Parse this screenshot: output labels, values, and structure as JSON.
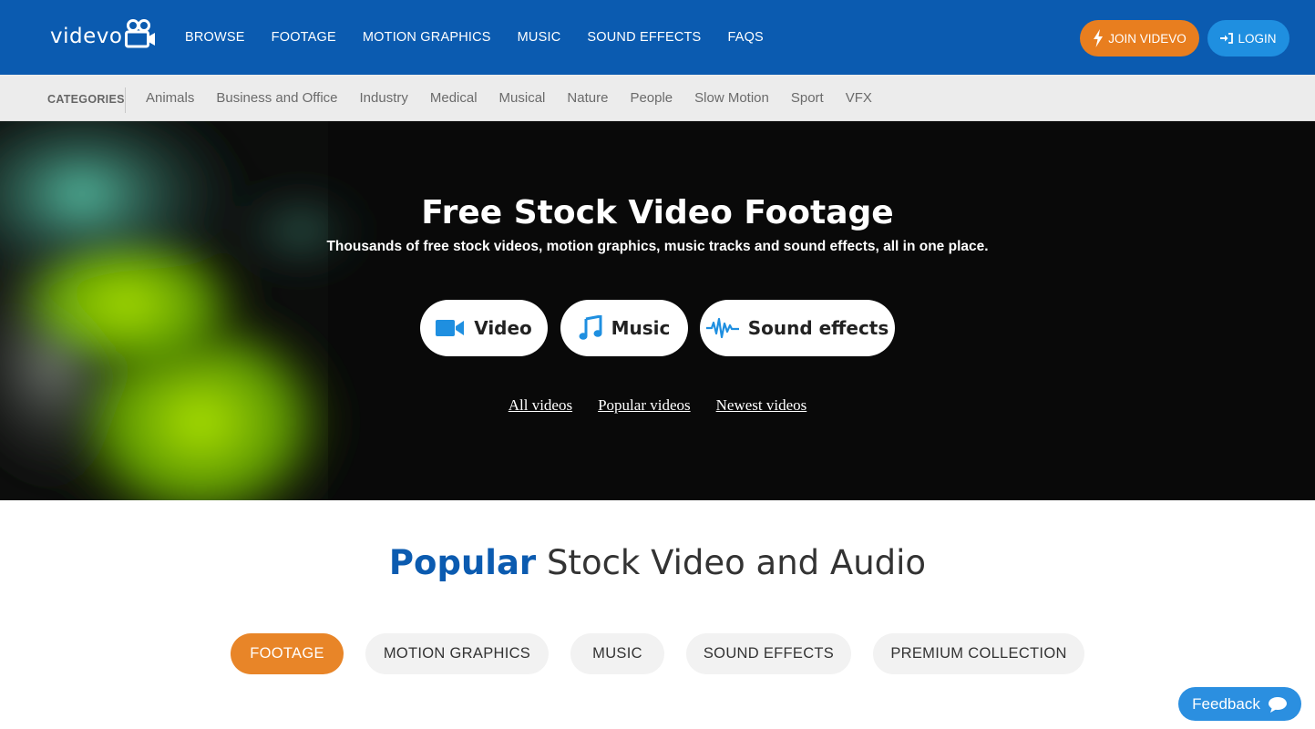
{
  "brand": {
    "name": "videvo"
  },
  "nav": {
    "items": [
      "BROWSE",
      "FOOTAGE",
      "MOTION GRAPHICS",
      "MUSIC",
      "SOUND EFFECTS",
      "FAQS"
    ],
    "join_label": "JOIN VIDEVO",
    "login_label": "LOGIN"
  },
  "categories": {
    "label": "CATEGORIES",
    "items": [
      "Animals",
      "Business and Office",
      "Industry",
      "Medical",
      "Musical",
      "Nature",
      "People",
      "Slow Motion",
      "Sport",
      "VFX"
    ]
  },
  "hero": {
    "title": "Free Stock Video Footage",
    "subtitle": "Thousands of free stock videos, motion graphics, music tracks and sound effects, all in one place.",
    "buttons": {
      "video": "Video",
      "music": "Music",
      "sfx": "Sound effects"
    },
    "links": [
      "All videos",
      "Popular videos",
      "Newest videos"
    ]
  },
  "popular": {
    "highlight": "Popular",
    "rest": " Stock Video and Audio",
    "tabs": [
      "FOOTAGE",
      "MOTION GRAPHICS",
      "MUSIC",
      "SOUND EFFECTS",
      "PREMIUM COLLECTION"
    ],
    "active_tab": "FOOTAGE"
  },
  "feedback": {
    "label": "Feedback"
  },
  "colors": {
    "nav_bg": "#0b5bb0",
    "accent_orange": "#e87e1f",
    "accent_blue": "#1f8fe0",
    "icon_blue": "#1f8fe0"
  }
}
